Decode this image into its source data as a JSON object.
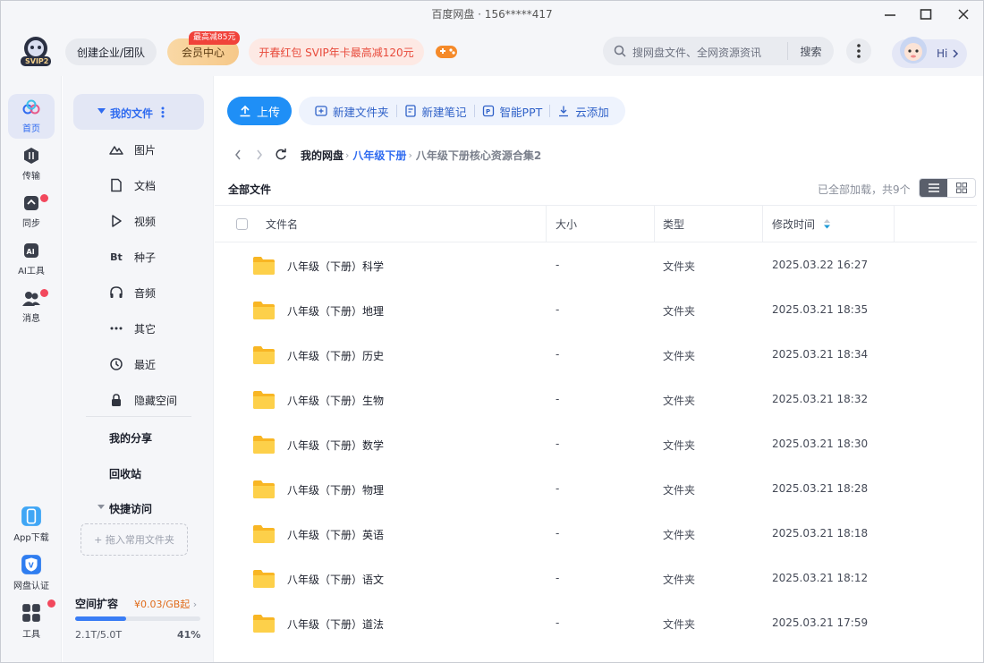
{
  "window": {
    "title": "百度网盘 · 156*****417"
  },
  "header": {
    "svip_label": "SVIP2",
    "team_button": "创建企业/团队",
    "vip_center": "会员中心",
    "vip_tag": "最高减85元",
    "promo": "开春红包 SVIP年卡最高减120元",
    "search_placeholder": "搜网盘文件、全网资源资讯",
    "search_button": "搜索",
    "greeting": "Hi"
  },
  "rail": {
    "items": [
      {
        "label": "首页",
        "icon": "cloud-icon"
      },
      {
        "label": "传输",
        "icon": "transfer-icon"
      },
      {
        "label": "同步",
        "icon": "sync-icon"
      },
      {
        "label": "AI工具",
        "icon": "ai-icon"
      },
      {
        "label": "消息",
        "icon": "message-icon"
      }
    ],
    "bottom": [
      {
        "label": "App下载",
        "icon": "phone-icon"
      },
      {
        "label": "网盘认证",
        "icon": "verify-icon"
      },
      {
        "label": "工具",
        "icon": "tools-icon"
      }
    ]
  },
  "sidenav": {
    "my_files": "我的文件",
    "items": [
      {
        "label": "图片",
        "icon": "image-icon"
      },
      {
        "label": "文档",
        "icon": "document-icon"
      },
      {
        "label": "视频",
        "icon": "video-icon"
      },
      {
        "label": "种子",
        "icon": "torrent-icon"
      },
      {
        "label": "音频",
        "icon": "audio-icon"
      },
      {
        "label": "其它",
        "icon": "other-icon"
      },
      {
        "label": "最近",
        "icon": "recent-icon"
      },
      {
        "label": "隐藏空间",
        "icon": "lock-icon"
      }
    ],
    "my_share": "我的分享",
    "recycle": "回收站",
    "quick_access": "快捷访问",
    "drop_hint": "+ 拖入常用文件夹",
    "storage": {
      "title": "空间扩容",
      "price": "¥0.03/GB起",
      "used": "2.1T/5.0T",
      "percent": "41%",
      "fraction": 0.41
    }
  },
  "toolbar": {
    "upload": "上传",
    "tools": [
      {
        "label": "新建文件夹",
        "icon": "new-folder-icon"
      },
      {
        "label": "新建笔记",
        "icon": "note-icon"
      },
      {
        "label": "智能PPT",
        "icon": "ppt-icon"
      },
      {
        "label": "云添加",
        "icon": "cloud-download-icon"
      }
    ]
  },
  "breadcrumb": {
    "root": "我的网盘",
    "mid": "八年级下册",
    "last": "八年级下册核心资源合集2"
  },
  "list": {
    "title": "全部文件",
    "status": "已全部加载，共9个",
    "columns": {
      "name": "文件名",
      "size": "大小",
      "type": "类型",
      "modified": "修改时间"
    },
    "rows": [
      {
        "name": "八年级（下册）科学",
        "size": "-",
        "type": "文件夹",
        "time": "2025.03.22 16:27"
      },
      {
        "name": "八年级（下册）地理",
        "size": "-",
        "type": "文件夹",
        "time": "2025.03.21 18:35"
      },
      {
        "name": "八年级（下册）历史",
        "size": "-",
        "type": "文件夹",
        "time": "2025.03.21 18:34"
      },
      {
        "name": "八年级（下册）生物",
        "size": "-",
        "type": "文件夹",
        "time": "2025.03.21 18:32"
      },
      {
        "name": "八年级（下册）数学",
        "size": "-",
        "type": "文件夹",
        "time": "2025.03.21 18:30"
      },
      {
        "name": "八年级（下册）物理",
        "size": "-",
        "type": "文件夹",
        "time": "2025.03.21 18:28"
      },
      {
        "name": "八年级（下册）英语",
        "size": "-",
        "type": "文件夹",
        "time": "2025.03.21 18:18"
      },
      {
        "name": "八年级（下册）语文",
        "size": "-",
        "type": "文件夹",
        "time": "2025.03.21 18:12"
      },
      {
        "name": "八年级（下册）道法",
        "size": "-",
        "type": "文件夹",
        "time": "2025.03.21 17:59"
      }
    ]
  },
  "colors": {
    "accent": "#1f8ff6",
    "active_blue": "#2f6bf0",
    "folder": "#fcc73e"
  }
}
